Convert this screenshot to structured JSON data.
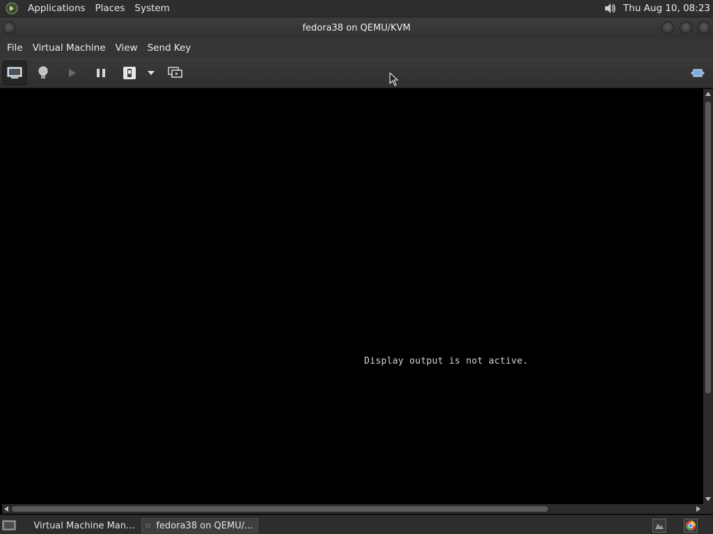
{
  "top_panel": {
    "menus": [
      "Applications",
      "Places",
      "System"
    ],
    "clock": "Thu Aug 10, 08:23",
    "icons": {
      "logo": "distro-logo-icon",
      "volume": "volume-icon"
    }
  },
  "window": {
    "title": "fedora38 on QEMU/KVM"
  },
  "menubar": {
    "items": [
      "File",
      "Virtual Machine",
      "View",
      "Send Key"
    ]
  },
  "toolbar": {
    "buttons": [
      {
        "name": "console-view",
        "icon": "monitor-icon",
        "active": true
      },
      {
        "name": "details-view",
        "icon": "lightbulb-icon",
        "active": false
      },
      {
        "name": "run",
        "icon": "play-icon",
        "active": false
      },
      {
        "name": "pause",
        "icon": "pause-icon",
        "active": false
      },
      {
        "name": "shutdown",
        "icon": "power-icon",
        "active": false
      },
      {
        "name": "shutdown-menu",
        "icon": "chevron-down-icon",
        "active": false
      },
      {
        "name": "snapshots",
        "icon": "snapshot-icon",
        "active": false
      },
      {
        "name": "fullscreen",
        "icon": "fullscreen-icon",
        "active": false
      }
    ]
  },
  "display": {
    "message": "Display output is not active."
  },
  "taskbar": {
    "tasks": [
      {
        "label": "Virtual Machine Man…",
        "active": false
      },
      {
        "label": "fedora38 on QEMU/…",
        "active": true
      }
    ],
    "icons": {
      "show_desktop": "show-desktop-icon",
      "tray1": "workspace-icon",
      "tray2": "browser-icon"
    }
  },
  "colors": {
    "panel_bg": "#2e2e2e",
    "menubar_bg": "#353535",
    "display_bg": "#000000",
    "text": "#e8e8e8"
  }
}
